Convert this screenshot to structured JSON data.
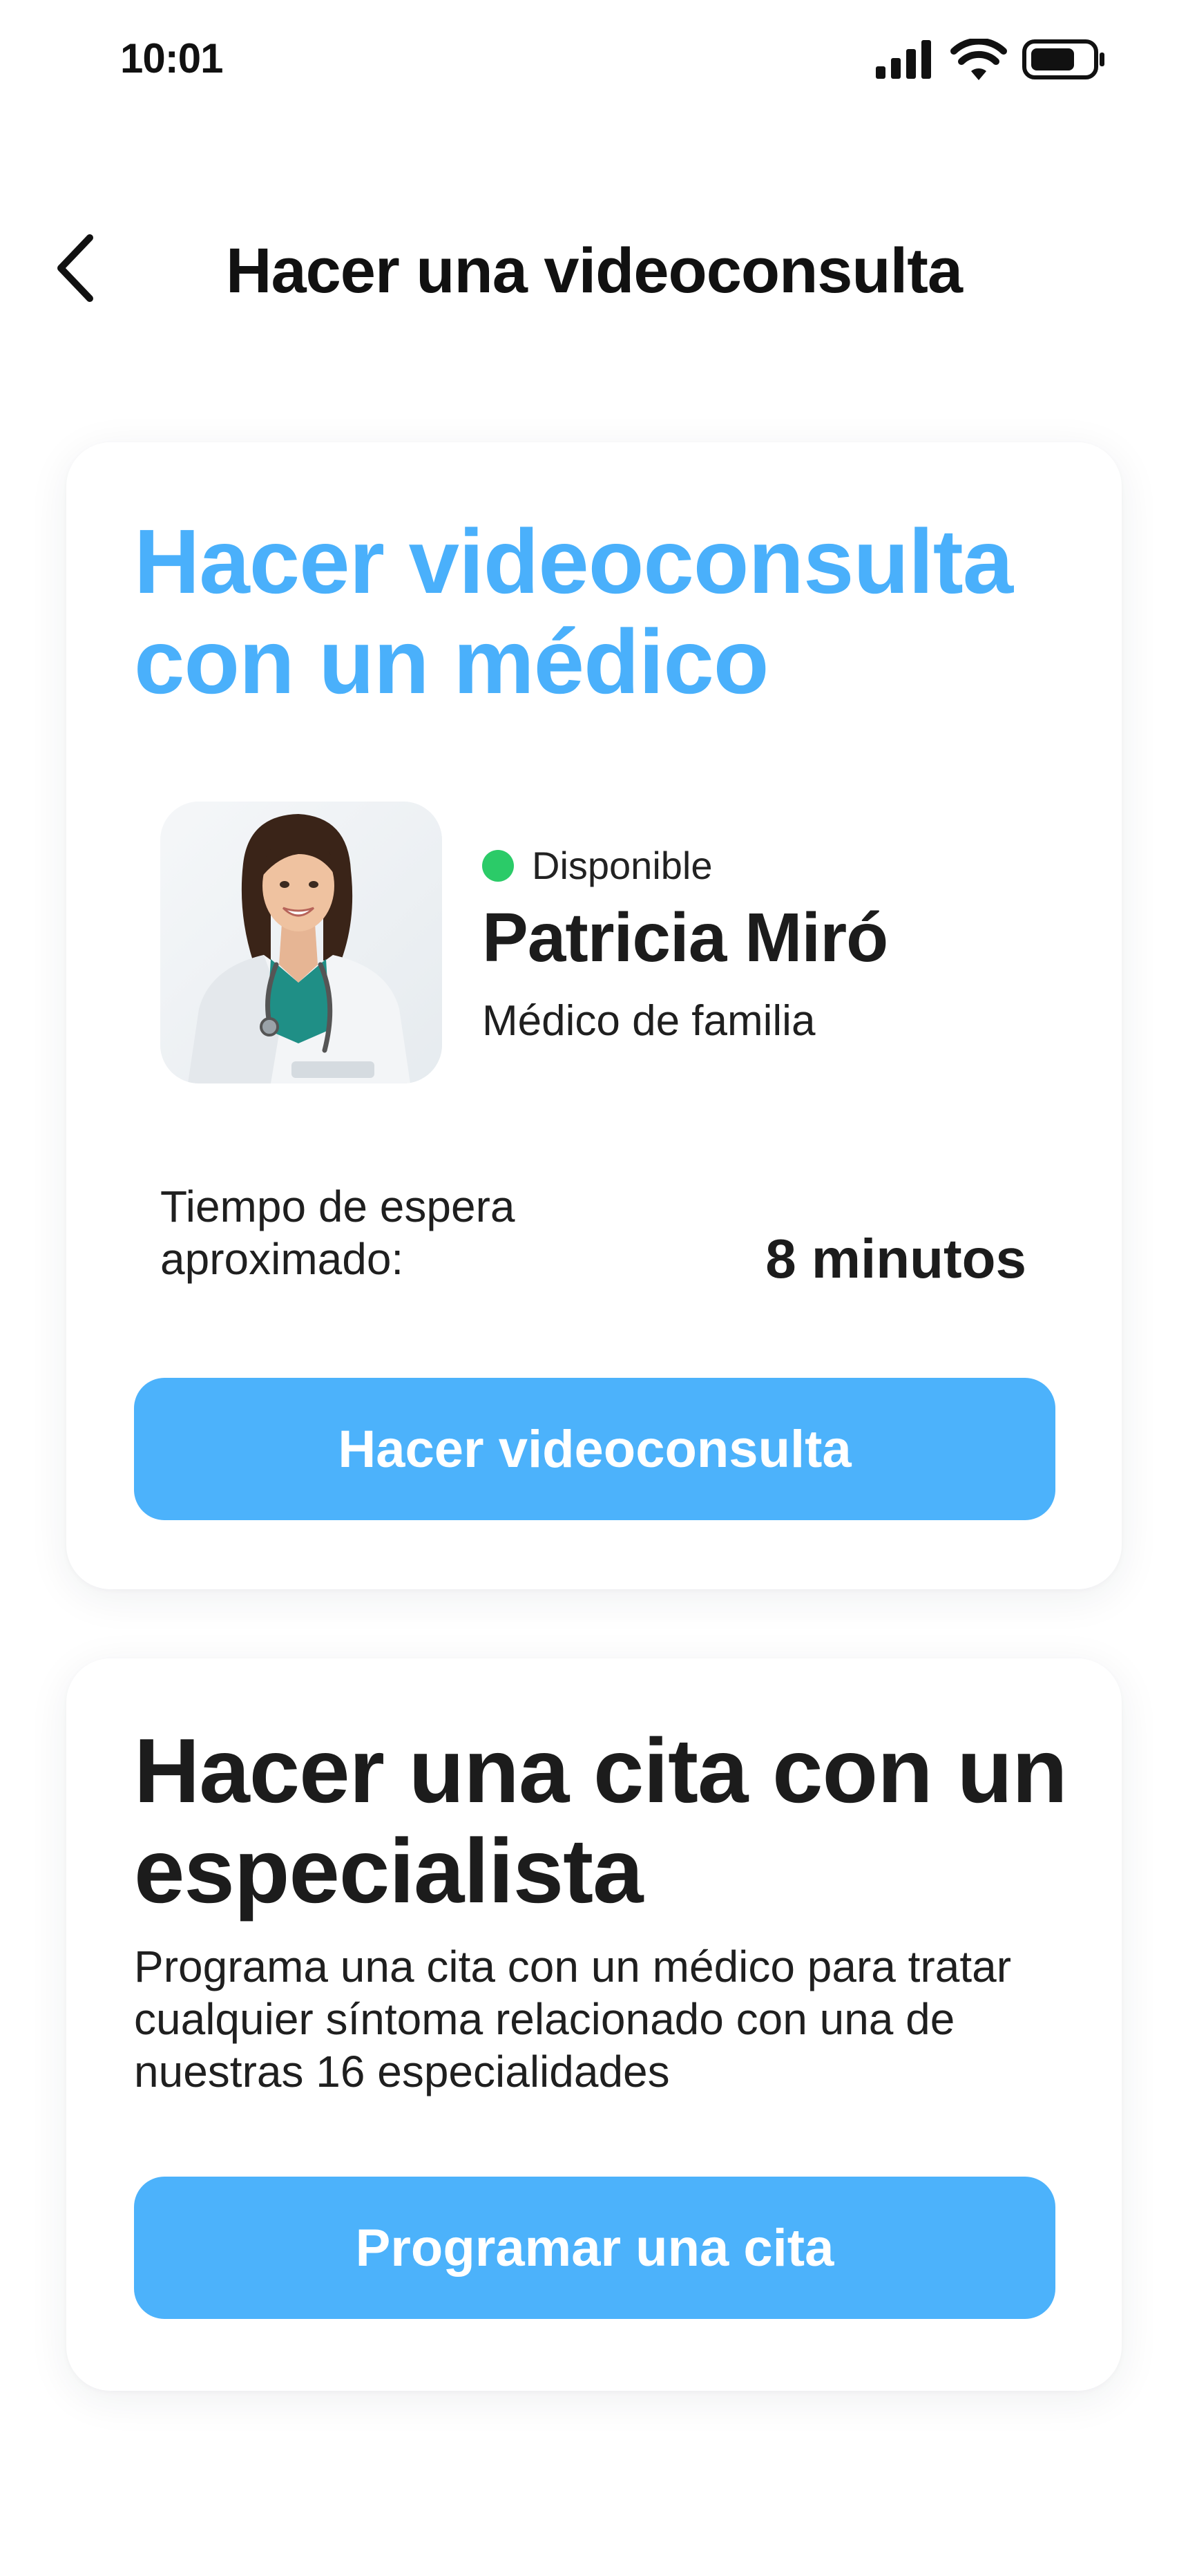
{
  "status_bar": {
    "time": "10:01",
    "icons": [
      "signal-icon",
      "wifi-icon",
      "battery-icon"
    ]
  },
  "header": {
    "title": "Hacer una videoconsulta",
    "back_icon": "chevron-left-icon"
  },
  "video_card": {
    "title": "Hacer videoconsulta con un médico",
    "doctor": {
      "status": "Disponible",
      "status_color": "#2bcb68",
      "name": "Patricia Miró",
      "specialty": "Médico de familia"
    },
    "wait_label": "Tiempo de espera aproximado:",
    "wait_value": "8 minutos",
    "button_label": "Hacer videoconsulta"
  },
  "specialist_card": {
    "title": "Hacer una cita con un especialista",
    "description": "Programa una cita con un médico para tratar cualquier síntoma relacionado con una de nuestras 16 especialidades",
    "button_label": "Programar una cita"
  },
  "colors": {
    "accent": "#4cb2fb",
    "accent_title": "#4ab0fb",
    "available": "#2bcb68",
    "text": "#1c1c1c"
  }
}
